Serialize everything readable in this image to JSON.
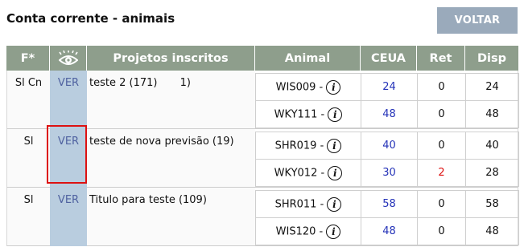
{
  "page": {
    "title": "Conta corrente - animais",
    "back_button": "VOLTAR"
  },
  "table": {
    "headers": {
      "f": "F*",
      "eye_icon": "eye-icon",
      "projetos": "Projetos inscritos",
      "animal": "Animal",
      "ceua": "CEUA",
      "ret": "Ret",
      "disp": "Disp"
    },
    "rows": [
      {
        "f": "Sl Cn",
        "ver": "VER",
        "project": "teste 2 (171)",
        "project_extra": "1)",
        "animals": [
          {
            "name": "WIS009 -",
            "ceua": "24",
            "ret": "0",
            "disp": "24"
          },
          {
            "name": "WKY111 -",
            "ceua": "48",
            "ret": "0",
            "disp": "48"
          }
        ]
      },
      {
        "f": "Sl",
        "ver": "VER",
        "project": "teste de nova previsão (19)",
        "animals": [
          {
            "name": "SHR019 -",
            "ceua": "40",
            "ret": "0",
            "disp": "40"
          },
          {
            "name": "WKY012 -",
            "ceua": "30",
            "ret": "2",
            "disp": "28"
          }
        ]
      },
      {
        "f": "Sl",
        "ver": "VER",
        "project": "Titulo para teste (109)",
        "animals": [
          {
            "name": "SHR011 -",
            "ceua": "58",
            "ret": "0",
            "disp": "58"
          },
          {
            "name": "WIS120 -",
            "ceua": "48",
            "ret": "0",
            "disp": "48"
          }
        ]
      }
    ]
  },
  "colors": {
    "header_bg": "#8e9e8c",
    "ver_column_bg": "#b9cddf",
    "link_blue": "#2533b8",
    "highlight_red": "#dd1111",
    "button_bg": "#9aaabb"
  },
  "icons": {
    "info": "info-icon",
    "eye": "eye-icon"
  }
}
